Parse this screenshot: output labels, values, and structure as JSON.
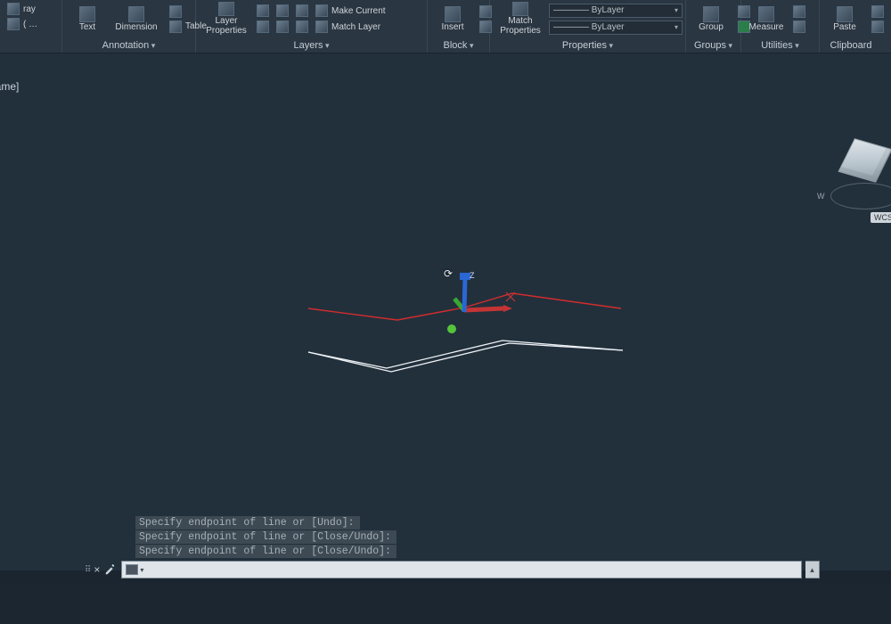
{
  "ribbon": {
    "p0": {
      "ray": "ray",
      "c": "( …"
    },
    "annotation": {
      "title": "Annotation",
      "text": "Text",
      "dimension": "Dimension",
      "table": "Table"
    },
    "layers": {
      "title": "Layers",
      "layer_properties": "Layer\nProperties",
      "make_current": "Make Current",
      "match_layer": "Match Layer"
    },
    "block": {
      "title": "Block",
      "insert": "Insert"
    },
    "properties": {
      "title": "Properties",
      "match": "Match\nProperties",
      "byLayer1": "———— ByLayer",
      "byLayer2": "———— ByLayer"
    },
    "groups": {
      "title": "Groups",
      "group": "Group"
    },
    "utilities": {
      "title": "Utilities",
      "measure": "Measure"
    },
    "clipboard": {
      "title": "Clipboard",
      "paste": "Paste"
    }
  },
  "canvas": {
    "viewlabel": "ireframe]",
    "zlabel": "Z",
    "wcs": "WCS"
  },
  "history": [
    "Specify endpoint of line or [Undo]:",
    "Specify endpoint of line or [Close/Undo]:",
    "Specify endpoint of line or [Close/Undo]:"
  ],
  "cmdline": {
    "prompt_icon": ">_"
  }
}
